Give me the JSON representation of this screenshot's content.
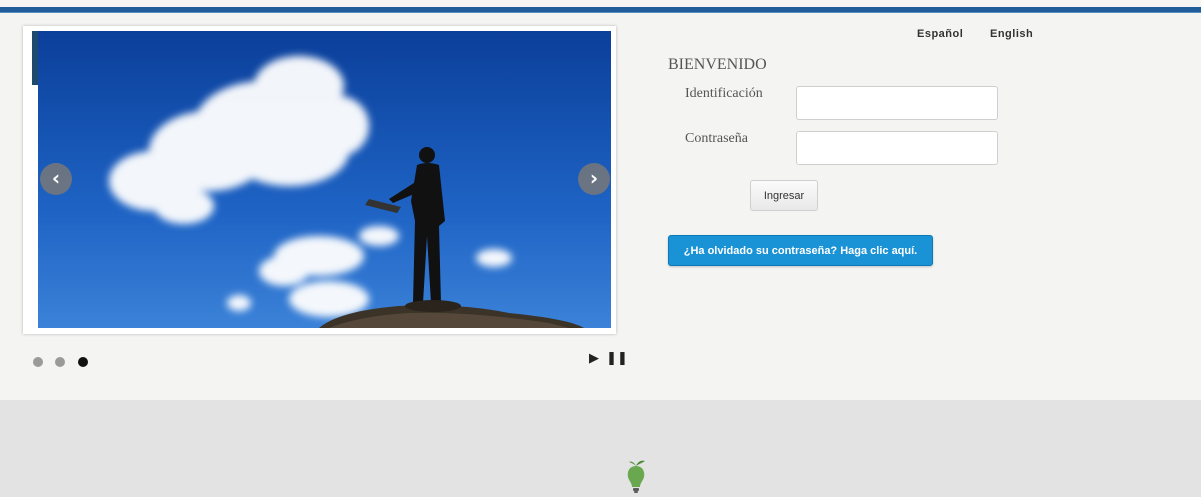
{
  "header": {
    "languages": [
      {
        "label": "Español"
      },
      {
        "label": "English"
      }
    ]
  },
  "slider": {
    "prev_icon": "chevron-left-icon",
    "next_icon": "chevron-right-icon",
    "prev_glyph": "‹",
    "next_glyph": "›",
    "slide_count": 3,
    "active_slide": 3,
    "play_glyph": "▶",
    "pause_glyph": "❚❚"
  },
  "login": {
    "title": "BIENVENIDO",
    "id_label": "Identificación",
    "id_value": "",
    "password_label": "Contraseña",
    "password_value": "",
    "submit_label": "Ingresar",
    "forgot_label": "¿Ha olvidado su contraseña? Haga clic aquí."
  },
  "footer": {
    "logo_icon": "lightbulb-logo-icon"
  },
  "colors": {
    "top_bar": "#1f5c99",
    "forgot_button": "#1a93d6",
    "footer_bg": "#e3e3e3",
    "logo_green": "#6aa84f"
  }
}
